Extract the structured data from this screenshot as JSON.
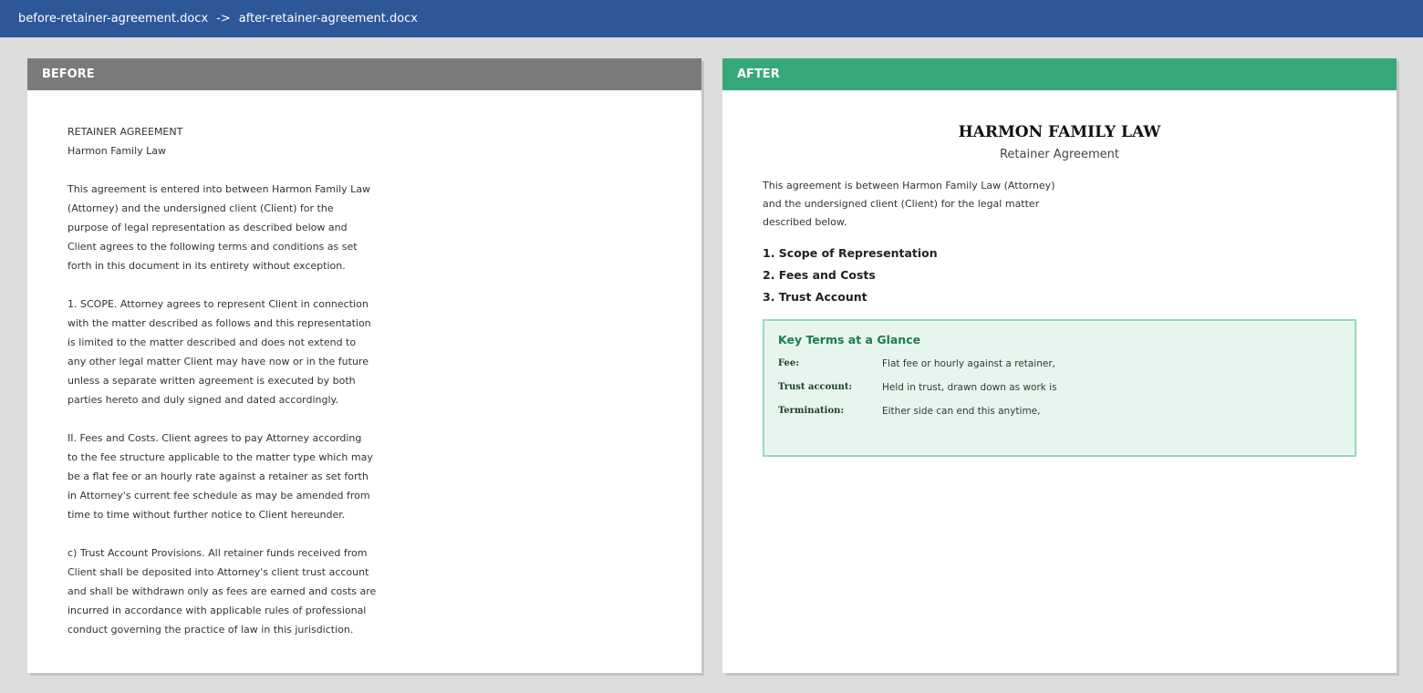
{
  "topbar": {
    "before_file": "before-retainer-agreement.docx",
    "arrow": "->",
    "after_file": "after-retainer-agreement.docx"
  },
  "before": {
    "header": "BEFORE",
    "paragraphs": [
      [
        "RETAINER AGREEMENT",
        "Harmon Family Law"
      ],
      [
        "This agreement is entered into between Harmon Family Law",
        "(Attorney) and the undersigned client (Client) for the",
        "purpose of legal representation as described below and",
        "Client agrees to the following terms and conditions as set",
        "forth in this document in its entirety without exception."
      ],
      [
        "1. SCOPE. Attorney agrees to represent Client in connection",
        "with the matter described as follows and this representation",
        "is limited to the matter described and does not extend to",
        "any other legal matter Client may have now or in the future",
        "unless a separate written agreement is executed by both",
        "parties hereto and duly signed and dated accordingly."
      ],
      [
        "II. Fees and Costs. Client agrees to pay Attorney according",
        "to the fee structure applicable to the matter type which may",
        "be a flat fee or an hourly rate against a retainer as set forth",
        "in Attorney's current fee schedule as may be amended from",
        "time to time without further notice to Client hereunder."
      ],
      [
        "c) Trust Account Provisions. All retainer funds received from",
        "Client shall be deposited into Attorney's client trust account",
        "and shall be withdrawn only as fees are earned and costs are",
        "incurred in accordance with applicable rules of professional",
        "conduct governing the practice of law in this jurisdiction."
      ]
    ]
  },
  "after": {
    "header": "AFTER",
    "title": "HARMON FAMILY LAW",
    "subtitle": "Retainer Agreement",
    "intro_lines": [
      "This agreement is between Harmon Family Law (Attorney)",
      "and the undersigned client (Client) for the legal matter",
      "described below."
    ],
    "sections": [
      "1. Scope of Representation",
      "2. Fees and Costs",
      "3. Trust Account"
    ],
    "key_terms": {
      "title": "Key Terms at a Glance",
      "rows": [
        {
          "label": "Fee:",
          "value": "Flat fee or hourly against a retainer,"
        },
        {
          "label": "Trust account:",
          "value": "Held in trust, drawn down as work is"
        },
        {
          "label": "Termination:",
          "value": "Either side can end this anytime,"
        }
      ]
    }
  },
  "colors": {
    "topbar": "#2e579a",
    "before_header": "#7a7a7a",
    "after_header": "#35a97a",
    "key_box_bg": "#e6f6ee",
    "key_box_border": "#98d7b9",
    "key_title": "#1f7a4c"
  }
}
